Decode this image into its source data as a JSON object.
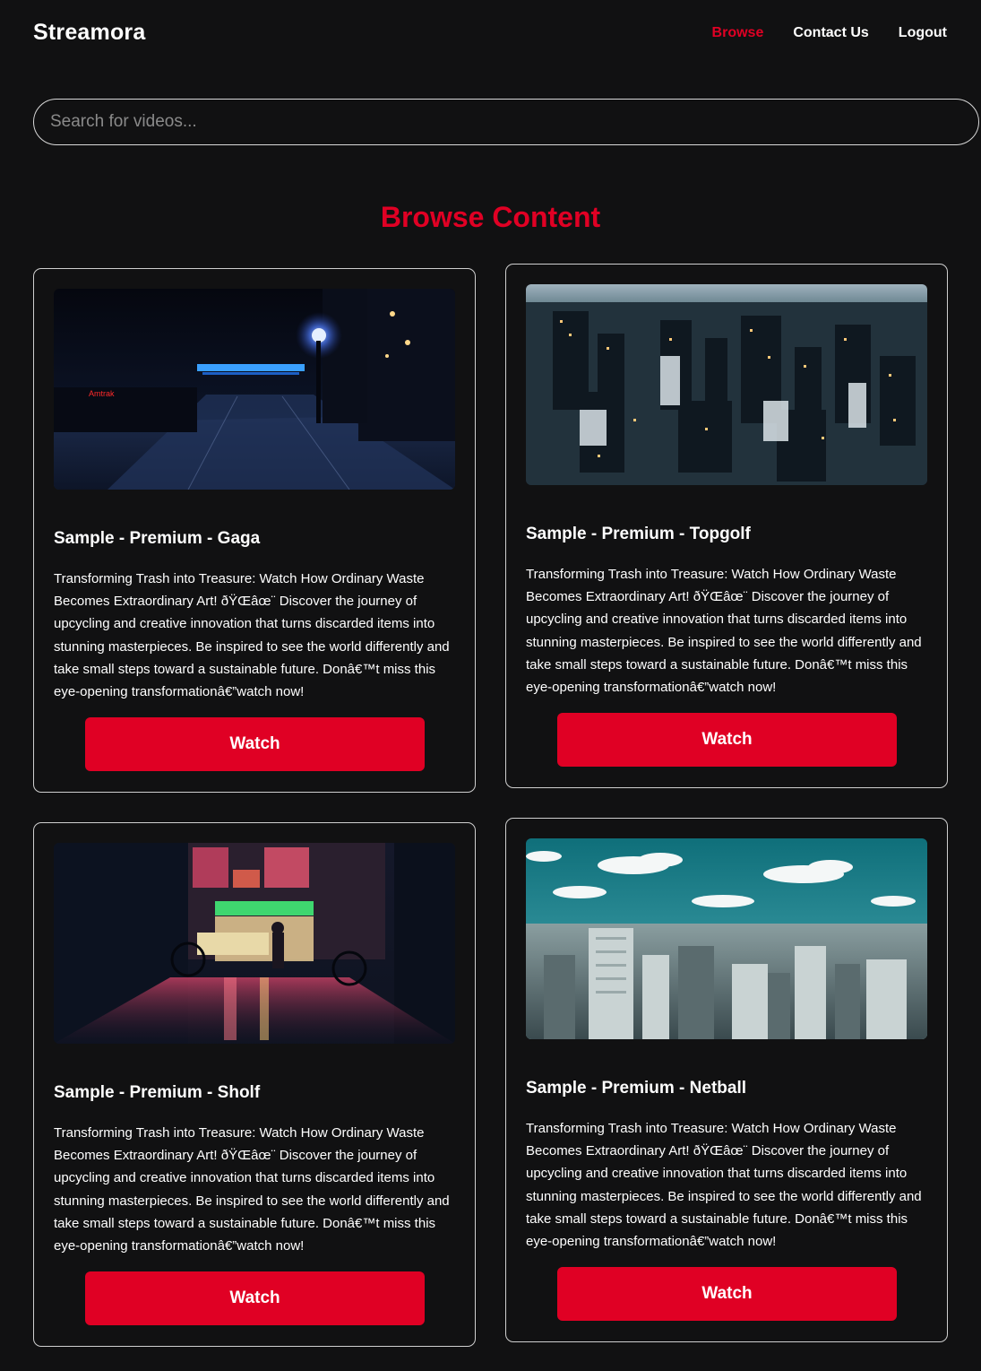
{
  "header": {
    "brand": "Streamora",
    "nav": {
      "browse": "Browse",
      "contact": "Contact Us",
      "logout": "Logout"
    }
  },
  "search": {
    "placeholder": "Search for videos..."
  },
  "main": {
    "section_title": "Browse Content",
    "cards": [
      {
        "title": "Sample - Premium - Gaga",
        "description": "Transforming Trash into Treasure: Watch How Ordinary Waste Becomes Extraordinary Art! ðŸŒâœ¨ Discover the journey of upcycling and creative innovation that turns discarded items into stunning masterpieces. Be inspired to see the world differently and take small steps toward a sustainable future. Donâ€™t miss this eye-opening transformationâ€”watch now!",
        "button": "Watch",
        "thumb_sign": "Amtrak"
      },
      {
        "title": "Sample - Premium - Topgolf",
        "description": "Transforming Trash into Treasure: Watch How Ordinary Waste Becomes Extraordinary Art! ðŸŒâœ¨ Discover the journey of upcycling and creative innovation that turns discarded items into stunning masterpieces. Be inspired to see the world differently and take small steps toward a sustainable future. Donâ€™t miss this eye-opening transformationâ€”watch now!",
        "button": "Watch"
      },
      {
        "title": "Sample - Premium - Sholf",
        "description": "Transforming Trash into Treasure: Watch How Ordinary Waste Becomes Extraordinary Art! ðŸŒâœ¨ Discover the journey of upcycling and creative innovation that turns discarded items into stunning masterpieces. Be inspired to see the world differently and take small steps toward a sustainable future. Donâ€™t miss this eye-opening transformationâ€”watch now!",
        "button": "Watch"
      },
      {
        "title": "Sample - Premium - Netball",
        "description": "Transforming Trash into Treasure: Watch How Ordinary Waste Becomes Extraordinary Art! ðŸŒâœ¨ Discover the journey of upcycling and creative innovation that turns discarded items into stunning masterpieces. Be inspired to see the world differently and take small steps toward a sustainable future. Donâ€™t miss this eye-opening transformationâ€”watch now!",
        "button": "Watch"
      }
    ]
  },
  "colors": {
    "accent": "#e00024",
    "background": "#111112",
    "border": "#cfcfcf"
  }
}
